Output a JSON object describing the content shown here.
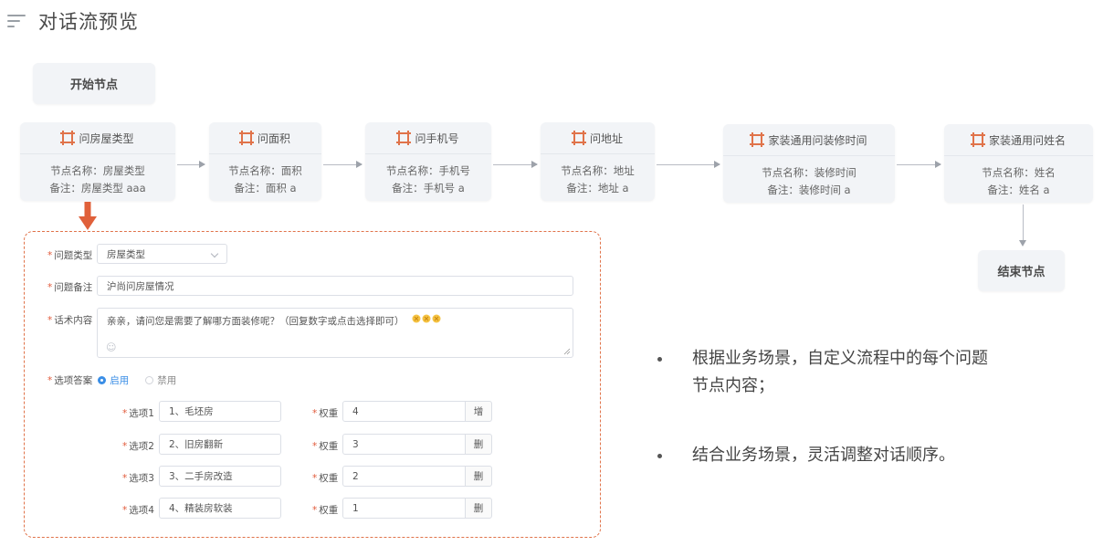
{
  "header": {
    "title": "对话流预览"
  },
  "flow": {
    "start_label": "开始节点",
    "end_label": "结束节点",
    "nodes": [
      {
        "title": "问房屋类型",
        "name_line": "节点名称：房屋类型",
        "note_line": "备注：房屋类型 aaa"
      },
      {
        "title": "问面积",
        "name_line": "节点名称：面积",
        "note_line": "备注：面积 a"
      },
      {
        "title": "问手机号",
        "name_line": "节点名称：手机号",
        "note_line": "备注：手机号 a"
      },
      {
        "title": "问地址",
        "name_line": "节点名称：地址",
        "note_line": "备注：地址 a"
      },
      {
        "title": "家装通用问装修时间",
        "name_line": "节点名称：装修时间",
        "note_line": "备注：装修时间 a"
      },
      {
        "title": "家装通用问姓名",
        "name_line": "节点名称：姓名",
        "note_line": "备注：姓名 a"
      }
    ]
  },
  "form": {
    "type_label": "问题类型",
    "type_value": "房屋类型",
    "note_label": "问题备注",
    "note_value": "沪尚问房屋情况",
    "script_label": "话术内容",
    "script_value": "亲亲，请问您是需要了解哪方面装修呢？（回复数字或点击选择即可）",
    "emoji_hint": "☺",
    "answer_label": "选项答案",
    "enable_label": "启用",
    "disable_label": "禁用",
    "weight_label": "权重",
    "options": [
      {
        "label": "选项1",
        "value": "1、毛坯房",
        "weight": "4",
        "action": "增"
      },
      {
        "label": "选项2",
        "value": "2、旧房翻新",
        "weight": "3",
        "action": "删"
      },
      {
        "label": "选项3",
        "value": "3、二手房改造",
        "weight": "2",
        "action": "删"
      },
      {
        "label": "选项4",
        "value": "4、精装房软装",
        "weight": "1",
        "action": "删"
      }
    ]
  },
  "bullets": [
    {
      "line1": "根据业务场景，自定义流程中的每个问题",
      "line2": "节点内容；"
    },
    {
      "line1": "结合业务场景，灵活调整对话顺序。"
    }
  ],
  "colors": {
    "accent": "#e0734a",
    "node_bg": "#f2f4f7",
    "radio": "#3a8ee6"
  }
}
